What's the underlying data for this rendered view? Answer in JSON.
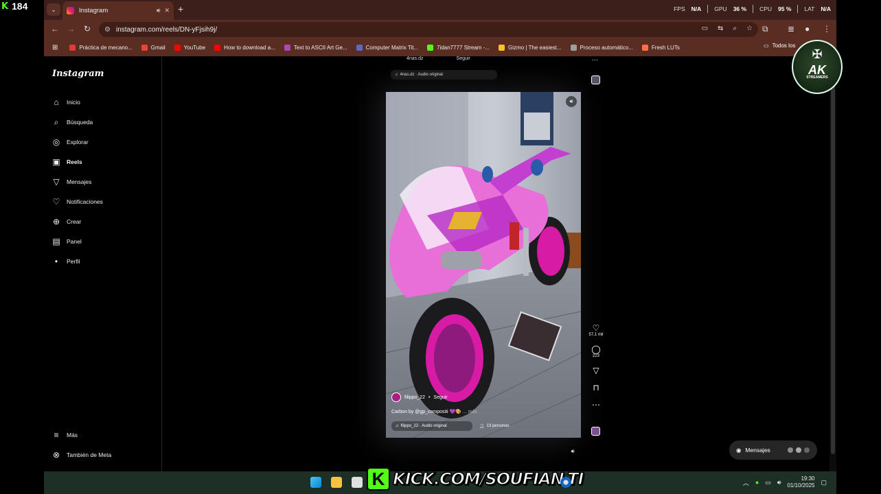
{
  "overlay": {
    "kick_count": "184",
    "kick_url": "KICK.COM/SOUFIAN-TI",
    "badge_title": "AK",
    "badge_subtitle": "STREAMERS"
  },
  "browser": {
    "tab_title": "Instagram",
    "url": "instagram.com/reels/DN-yFjsih9j/",
    "perf": {
      "fps_label": "FPS",
      "fps_value": "N/A",
      "gpu_label": "GPU",
      "gpu_value": "36 %",
      "cpu_label": "CPU",
      "cpu_value": "95 %",
      "lat_label": "LAT",
      "lat_value": "N/A"
    },
    "bookmarks": [
      {
        "label": "Práctica de mecano...",
        "color": "#e53935"
      },
      {
        "label": "Gmail",
        "color": "#ea4335"
      },
      {
        "label": "YouTube",
        "color": "#ff0000"
      },
      {
        "label": "How to download a...",
        "color": "#ff0000"
      },
      {
        "label": "Text to ASCII Art Ge...",
        "color": "#ab47bc"
      },
      {
        "label": "Computer Matrix Tit...",
        "color": "#5c6bc0"
      },
      {
        "label": "7idan7777 Stream -...",
        "color": "#53fc18"
      },
      {
        "label": "Gizmo | The easiest...",
        "color": "#fbc02d"
      },
      {
        "label": "Proceso automático...",
        "color": "#9e9e9e"
      },
      {
        "label": "Fresh LUTs",
        "color": "#ff7043"
      }
    ],
    "all_bookmarks": "Todos los"
  },
  "instagram": {
    "logo": "Instagram",
    "nav": [
      {
        "label": "Inicio",
        "icon": "home-icon",
        "glyph": "⌂"
      },
      {
        "label": "Búsqueda",
        "icon": "search-icon",
        "glyph": "⌕"
      },
      {
        "label": "Explorar",
        "icon": "compass-icon",
        "glyph": "◎"
      },
      {
        "label": "Reels",
        "icon": "reels-icon",
        "glyph": "▣"
      },
      {
        "label": "Mensajes",
        "icon": "send-icon",
        "glyph": "▽"
      },
      {
        "label": "Notificaciones",
        "icon": "heart-icon",
        "glyph": "♡"
      },
      {
        "label": "Crear",
        "icon": "plus-icon",
        "glyph": "⊕"
      },
      {
        "label": "Panel",
        "icon": "dashboard-icon",
        "glyph": "▤"
      },
      {
        "label": "Perfil",
        "icon": "profile-icon",
        "glyph": "•"
      }
    ],
    "nav_bottom": [
      {
        "label": "Más",
        "icon": "menu-icon",
        "glyph": "≡"
      },
      {
        "label": "También de Meta",
        "icon": "meta-icon",
        "glyph": "⊗"
      }
    ],
    "prev_reel": {
      "user": "4nas.dz",
      "follow": "Seguir",
      "audio": "4nas.dz · Audio original"
    },
    "reel": {
      "user": "filippo_22",
      "follow": "Seguir",
      "caption": "Carbon by @gp_compositi 💜🎨",
      "more": "... más",
      "audio": "filippo_22 · Audio original",
      "people": "13 personas",
      "likes": "57,1 mil",
      "comments": "223"
    },
    "messages_label": "Mensajes"
  },
  "taskbar": {
    "time": "19:30",
    "date": "01/10/2025"
  }
}
